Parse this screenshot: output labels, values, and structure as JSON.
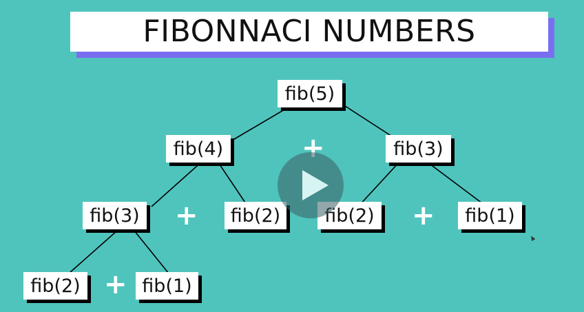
{
  "title": "FIBONNACI NUMBERS",
  "nodes": {
    "fib5": "fib(5)",
    "fib4": "fib(4)",
    "fib3_right": "fib(3)",
    "fib3_left": "fib(3)",
    "fib2_a": "fib(2)",
    "fib2_b": "fib(2)",
    "fib1_a": "fib(1)",
    "fib2_c": "fib(2)",
    "fib1_b": "fib(1)"
  },
  "operator": "+",
  "icons": {
    "play": "play-icon",
    "cursor": "cursor-icon"
  },
  "colors": {
    "background": "#4fc4bd",
    "title_shadow": "#7a6ef0",
    "node_shadow": "#000000"
  }
}
